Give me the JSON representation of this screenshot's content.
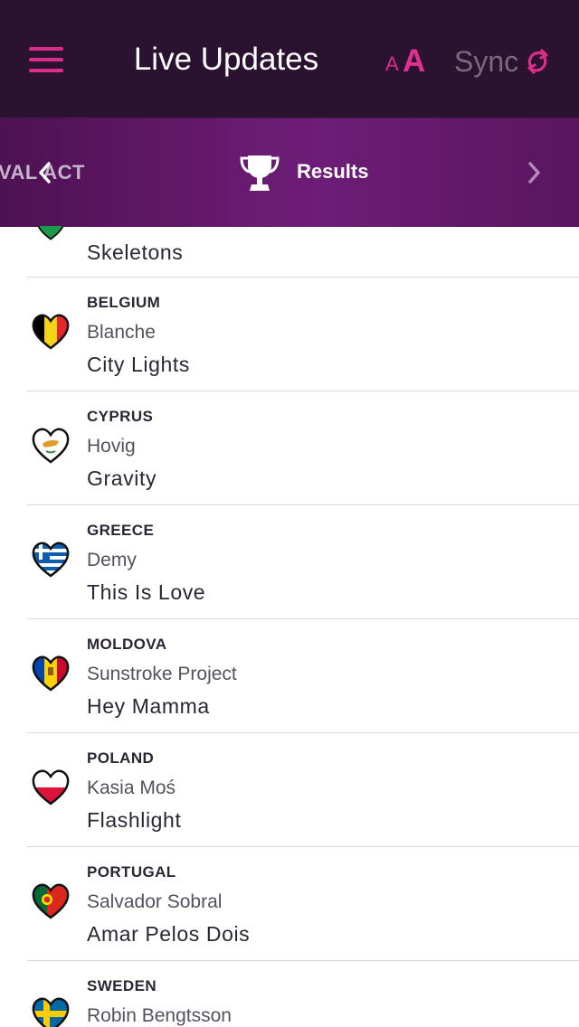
{
  "header": {
    "title": "Live Updates",
    "text_size_small": "A",
    "text_size_large": "A",
    "sync_label": "Sync",
    "background_color": "#2b1230",
    "accent_color": "#d92f8a"
  },
  "section_nav": {
    "previous_label": "VAL ACT",
    "current_label": "Results",
    "current_icon": "trophy-icon"
  },
  "entries": [
    {
      "country": "",
      "artist": "",
      "song": "Skeletons",
      "flag_icon": "flag-heart-green"
    },
    {
      "country": "BELGIUM",
      "artist": "Blanche",
      "song": "City Lights",
      "flag_icon": "flag-heart-belgium"
    },
    {
      "country": "CYPRUS",
      "artist": "Hovig",
      "song": "Gravity",
      "flag_icon": "flag-heart-cyprus"
    },
    {
      "country": "GREECE",
      "artist": "Demy",
      "song": "This Is Love",
      "flag_icon": "flag-heart-greece"
    },
    {
      "country": "MOLDOVA",
      "artist": "Sunstroke Project",
      "song": "Hey Mamma",
      "flag_icon": "flag-heart-moldova"
    },
    {
      "country": "POLAND",
      "artist": "Kasia Moś",
      "song": "Flashlight",
      "flag_icon": "flag-heart-poland"
    },
    {
      "country": "PORTUGAL",
      "artist": "Salvador Sobral",
      "song": "Amar Pelos Dois",
      "flag_icon": "flag-heart-portugal"
    },
    {
      "country": "SWEDEN",
      "artist": "Robin Bengtsson",
      "song": "",
      "flag_icon": "flag-heart-sweden"
    }
  ]
}
